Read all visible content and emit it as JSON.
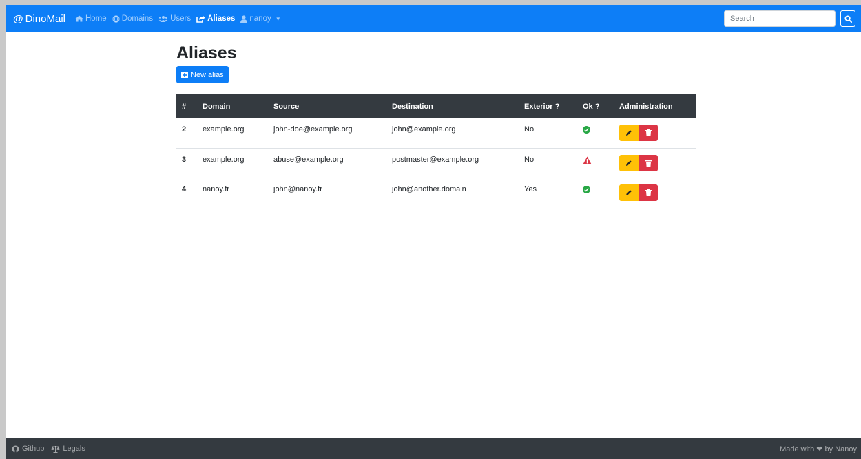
{
  "brand": {
    "symbol": "@",
    "name": "DinoMail"
  },
  "nav": {
    "items": [
      {
        "label": "Home",
        "icon": "home-icon"
      },
      {
        "label": "Domains",
        "icon": "globe-icon"
      },
      {
        "label": "Users",
        "icon": "users-icon"
      },
      {
        "label": "Aliases",
        "icon": "share-icon",
        "active": true
      },
      {
        "label": "nanoy",
        "icon": "user-icon"
      }
    ]
  },
  "search": {
    "placeholder": "Search",
    "value": ""
  },
  "page": {
    "title": "Aliases",
    "new_button": "New alias"
  },
  "table": {
    "headers": [
      "#",
      "Domain",
      "Source",
      "Destination",
      "Exterior ?",
      "Ok ?",
      "Administration"
    ],
    "rows": [
      {
        "id": "2",
        "domain": "example.org",
        "source": "john-doe@example.org",
        "destination": "john@example.org",
        "exterior": "No",
        "ok": "check-circle-icon"
      },
      {
        "id": "3",
        "domain": "example.org",
        "source": "abuse@example.org",
        "destination": "postmaster@example.org",
        "exterior": "No",
        "ok": "warning-triangle-icon"
      },
      {
        "id": "4",
        "domain": "nanoy.fr",
        "source": "john@nanoy.fr",
        "destination": "john@another.domain",
        "exterior": "Yes",
        "ok": "check-circle-icon"
      }
    ]
  },
  "footer": {
    "github": "Github",
    "legals": "Legals",
    "made_with": "Made with ❤ by Nanoy"
  },
  "colors": {
    "primary": "#0d7ef7",
    "dark": "#343a40",
    "warning": "#ffc107",
    "danger": "#dc3545",
    "success": "#28a745"
  }
}
